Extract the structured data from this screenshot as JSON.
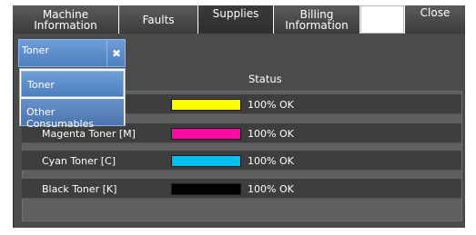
{
  "tabs": {
    "machine_information": "Machine\nInformation",
    "faults": "Faults",
    "supplies": "Supplies",
    "billing_information": "Billing\nInformation",
    "close": "Close"
  },
  "dropdown": {
    "selected": "Toner",
    "clear_icon": "close-icon"
  },
  "menu": {
    "items": [
      "Toner",
      "Other Consumables"
    ]
  },
  "table": {
    "status_header": "Status",
    "rows": [
      {
        "label": "",
        "color": "#ffff00",
        "level": 100,
        "status": "100% OK"
      },
      {
        "label": "Magenta Toner [M]",
        "color": "#ff0aa5",
        "level": 100,
        "status": "100% OK"
      },
      {
        "label": "Cyan Toner [C]",
        "color": "#00c0f0",
        "level": 100,
        "status": "100% OK"
      },
      {
        "label": "Black Toner [K]",
        "color": "#000000",
        "level": 100,
        "status": "100% OK"
      }
    ]
  }
}
